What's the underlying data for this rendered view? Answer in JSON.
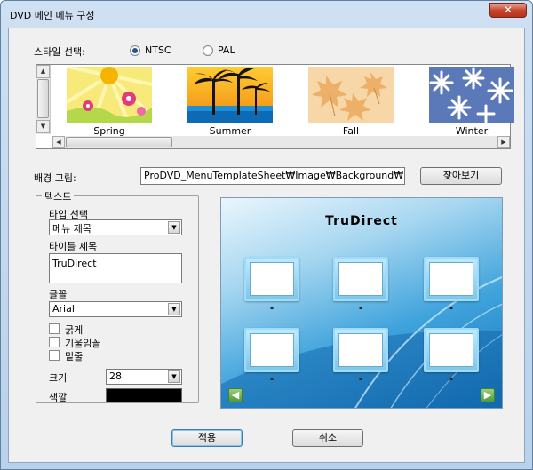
{
  "window": {
    "title": "DVD 메인 메뉴 구성",
    "close_label": "✕"
  },
  "style_select": {
    "label": "스타일 선택:",
    "options": [
      {
        "label": "NTSC",
        "checked": true
      },
      {
        "label": "PAL",
        "checked": false
      }
    ]
  },
  "gallery": {
    "items": [
      {
        "caption": "Spring"
      },
      {
        "caption": "Summer"
      },
      {
        "caption": "Fall"
      },
      {
        "caption": "Winter"
      }
    ]
  },
  "background": {
    "label": "배경 그림:",
    "path": "ProDVD_MenuTemplateSheet₩Image₩Background₩NT",
    "browse_label": "찾아보기"
  },
  "text_group": {
    "legend": "텍스트",
    "type_label": "타입 선택",
    "type_value": "메뉴 제목",
    "title_label": "타이틀 제목",
    "title_value": "TruDirect",
    "font_label": "글꼴",
    "font_value": "Arial",
    "bold_label": "굵게",
    "italic_label": "기울임꼴",
    "underline_label": "밑줄",
    "size_label": "크기",
    "size_value": "28",
    "color_label": "색깔",
    "color_value": "#000000"
  },
  "preview": {
    "title": "TruDirect"
  },
  "buttons": {
    "apply_label": "적용",
    "cancel_label": "취소"
  },
  "colors": {
    "accent": "#3c7fb1",
    "preview_dark": "#1572b5",
    "preview_light": "#eaf6fd"
  }
}
